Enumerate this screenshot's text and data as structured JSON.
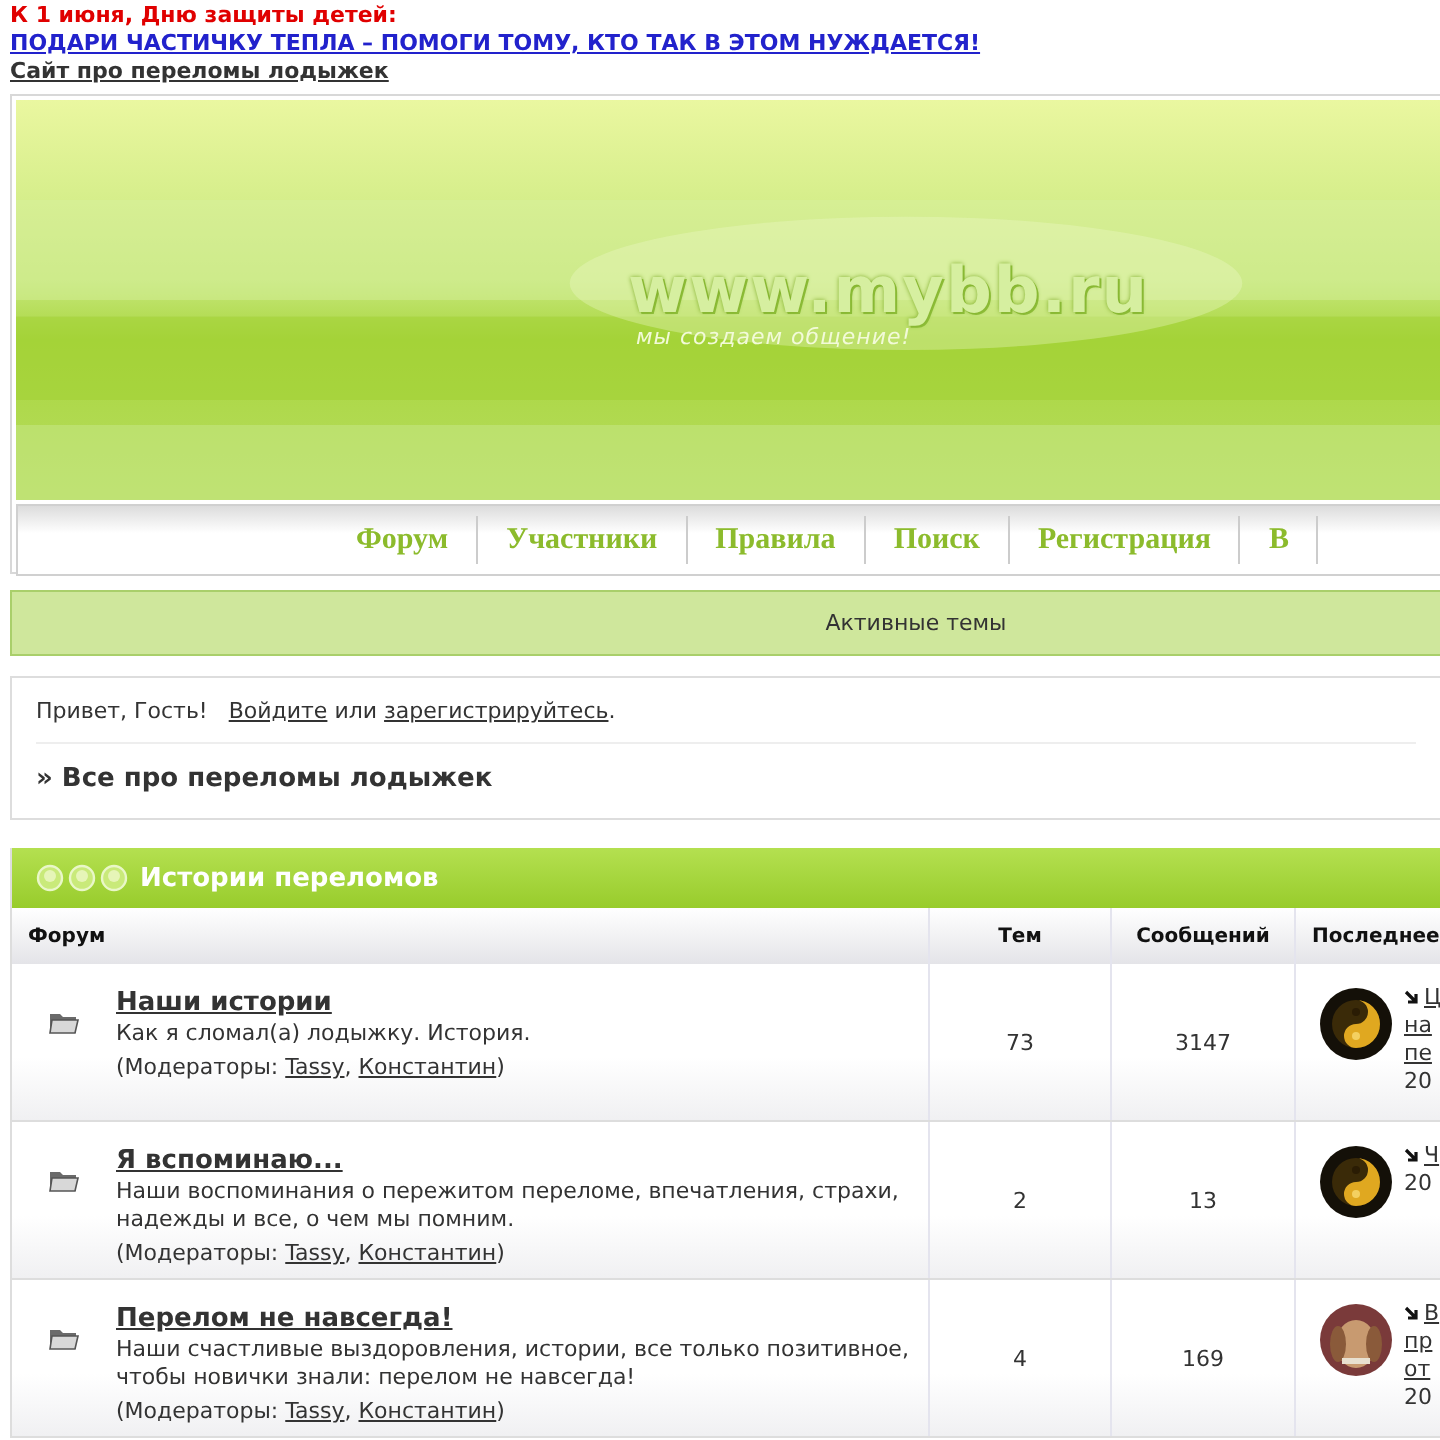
{
  "announcement": {
    "heading": "К 1 июня, Дню защиты детей:",
    "link": "ПОДАРИ ЧАСТИЧКУ ТЕПЛА – ПОМОГИ ТОМУ, КТО ТАК В ЭТОМ НУЖДАЕТСЯ!"
  },
  "site_link": "Сайт про переломы лодыжек",
  "banner": {
    "logo": "www.mybb.ru",
    "slogan": "мы создаем общение!"
  },
  "nav": [
    {
      "label": "Форум"
    },
    {
      "label": "Участники"
    },
    {
      "label": "Правила"
    },
    {
      "label": "Поиск"
    },
    {
      "label": "Регистрация"
    },
    {
      "label": "В"
    }
  ],
  "active_topics": "Активные темы",
  "welcome": {
    "greeting": "Привет, Гость!",
    "login": "Войдите",
    "or": "или",
    "register": "зарегистрируйтесь",
    "end": "."
  },
  "breadcrumb": "» Все про переломы лодыжек",
  "category": {
    "title": "Истории переломов",
    "columns": [
      "Форум",
      "Тем",
      "Сообщений",
      "Последнее"
    ],
    "forums": [
      {
        "name": "Наши истории",
        "description": "Как я сломал(а) лодыжку. История.",
        "moderators": {
          "prefix": "(Модераторы:",
          "names": [
            "Tassy",
            "Константин"
          ],
          "separator": ",",
          "suffix": ")"
        },
        "topics": "73",
        "posts": "3147",
        "avatar": {
          "kind": "dark"
        },
        "last_post": {
          "links": [
            "Ц",
            "на",
            "пе"
          ],
          "date": "20"
        }
      },
      {
        "name": "Я вспоминаю...",
        "description": "Наши воспоминания о пережитом переломе, впечатления, страхи, надежды и все, о чем мы помним.",
        "moderators": {
          "prefix": "(Модераторы:",
          "names": [
            "Tassy",
            "Константин"
          ],
          "separator": ",",
          "suffix": ")"
        },
        "topics": "2",
        "posts": "13",
        "avatar": {
          "kind": "dark"
        },
        "last_post": {
          "links": [
            "Ч"
          ],
          "date": "20"
        }
      },
      {
        "name": "Перелом не навсегда!",
        "description": "Наши счастливые выздоровления, истории, все только позитивное, чтобы новички знали: перелом не навсегда!",
        "moderators": {
          "prefix": "(Модераторы:",
          "names": [
            "Tassy",
            "Константин"
          ],
          "separator": ",",
          "suffix": ")"
        },
        "topics": "4",
        "posts": "169",
        "avatar": {
          "kind": "dog"
        },
        "last_post": {
          "links": [
            "В",
            "пр",
            "от"
          ],
          "date": "20"
        }
      }
    ]
  }
}
